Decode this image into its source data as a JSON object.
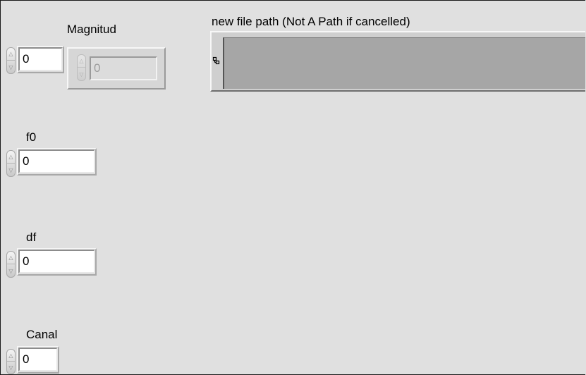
{
  "magnitud": {
    "label": "Magnitud",
    "control_value": "0",
    "indicator_value": "0"
  },
  "path": {
    "label": "new file path (Not A Path if cancelled)",
    "value": ""
  },
  "f0": {
    "label": "f0",
    "value": "0"
  },
  "df": {
    "label": "df",
    "value": "0"
  },
  "canal": {
    "label": "Canal",
    "value": "0"
  },
  "icons": {
    "increment": "chevron-up-icon",
    "decrement": "chevron-down-icon",
    "browse": "path-browse-icon"
  },
  "colors": {
    "panel": "#e0e0e0",
    "field_bg": "#ffffff",
    "path_field_bg": "#a6a6a6",
    "disabled_text": "#9c9c9c"
  }
}
